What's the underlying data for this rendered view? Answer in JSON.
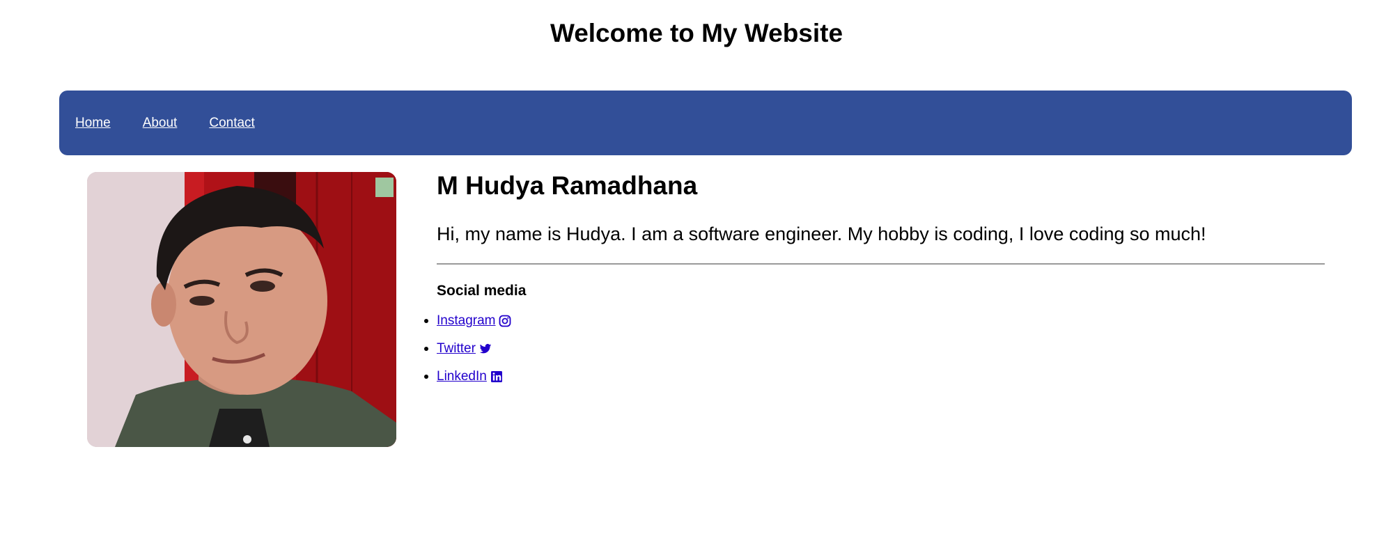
{
  "page": {
    "title": "Welcome to My Website"
  },
  "nav": {
    "items": [
      {
        "label": "Home"
      },
      {
        "label": "About"
      },
      {
        "label": "Contact"
      }
    ]
  },
  "profile": {
    "name": "M Hudya Ramadhana",
    "bio": "Hi, my name is Hudya. I am a software engineer. My hobby is coding, I love coding so much!",
    "social_heading": "Social media",
    "social_links": [
      {
        "label": "Instagram",
        "icon": "instagram-icon"
      },
      {
        "label": "Twitter",
        "icon": "twitter-icon"
      },
      {
        "label": "LinkedIn",
        "icon": "linkedin-icon"
      }
    ]
  },
  "colors": {
    "navbar_background": "#324f98",
    "nav_link": "#ffffff",
    "social_link": "#2200cc"
  }
}
